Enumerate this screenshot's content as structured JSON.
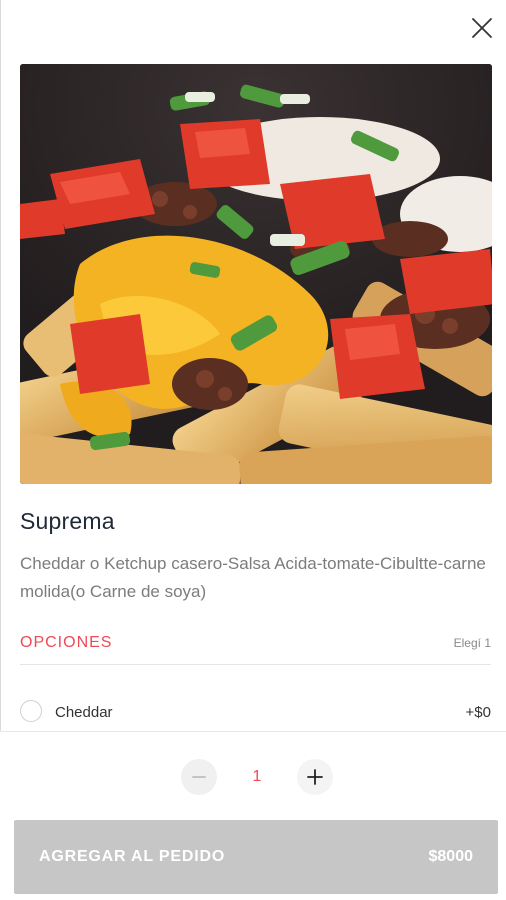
{
  "product": {
    "name": "Suprema",
    "description": "Cheddar o Ketchup casero-Salsa Acida-tomate-Cibultte-carne molida(o Carne de soya)",
    "image_icon": "loaded-fries-photo"
  },
  "options": {
    "header_label": "OPCIONES",
    "choose_hint": "Elegí 1",
    "items": [
      {
        "name": "Cheddar",
        "price": "+$0",
        "selected": false
      }
    ]
  },
  "quantity": {
    "value": "1"
  },
  "cta": {
    "label": "AGREGAR AL PEDIDO",
    "price": "$8000"
  },
  "colors": {
    "accent": "#ee4a55",
    "title": "#1f2937",
    "muted": "#7c7c7c",
    "cta_disabled": "#c6c6c6"
  },
  "icons": {
    "close": "close-icon",
    "minus": "minus-icon",
    "plus": "plus-icon"
  }
}
